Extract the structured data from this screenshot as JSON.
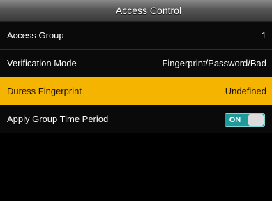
{
  "header": {
    "title": "Access Control"
  },
  "menu": {
    "items": [
      {
        "label": "Access Group",
        "value": "1"
      },
      {
        "label": "Verification Mode",
        "value": "Fingerprint/Password/Bad"
      },
      {
        "label": "Duress Fingerprint",
        "value": "Undefined"
      },
      {
        "label": "Apply Group Time Period",
        "toggle": "ON"
      }
    ]
  },
  "colors": {
    "selected": "#f5b400",
    "toggle": "#1f9a9a"
  }
}
